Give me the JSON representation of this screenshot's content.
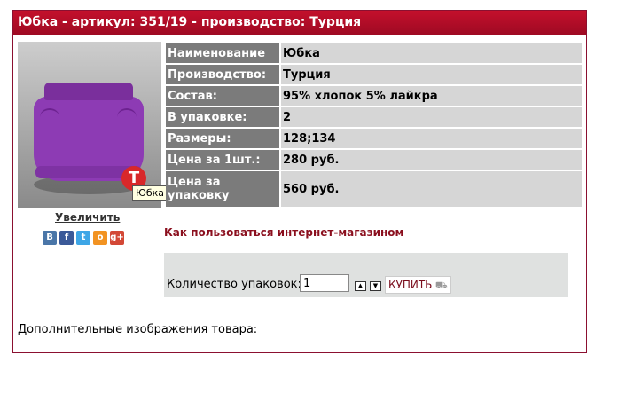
{
  "header": {
    "title": "Юбка - артикул: 351/19 - производство: Турция"
  },
  "image": {
    "tooltip": "Юбка",
    "brand_glyph": "T"
  },
  "zoom_label": "Увеличить",
  "social": [
    {
      "icon": "vk-icon",
      "glyph": "В",
      "color": "#4a76a8"
    },
    {
      "icon": "facebook-icon",
      "glyph": "f",
      "color": "#3b5998"
    },
    {
      "icon": "twitter-icon",
      "glyph": "t",
      "color": "#3ea6e6"
    },
    {
      "icon": "odnoklassniki-icon",
      "glyph": "о",
      "color": "#f29322"
    },
    {
      "icon": "google-plus-icon",
      "glyph": "g+",
      "color": "#d34836"
    }
  ],
  "properties": [
    {
      "key": "Наименование",
      "value": "Юбка"
    },
    {
      "key": "Производство:",
      "value": "Турция"
    },
    {
      "key": "Состав:",
      "value": "95% хлопок 5% лайкра"
    },
    {
      "key": "В упаковке:",
      "value": "2"
    },
    {
      "key": "Размеры:",
      "value": "128;134"
    },
    {
      "key": "Цена за 1шт.:",
      "value": "280 руб."
    },
    {
      "key": "Цена за упаковку",
      "value": "560 руб."
    }
  ],
  "how_to_link": "Как пользоваться интернет-магазином",
  "order": {
    "qty_label": "Количество упаковок:",
    "qty_value": "1",
    "buy_label": "КУПИТЬ",
    "buy_icon": "cart-icon"
  },
  "extra_images_label": "Дополнительные изображения товара:",
  "colors": {
    "title_bar": "#b30d28",
    "key_cell": "#7b7b7b",
    "value_cell": "#d6d6d6",
    "link": "#8b0f1e"
  }
}
